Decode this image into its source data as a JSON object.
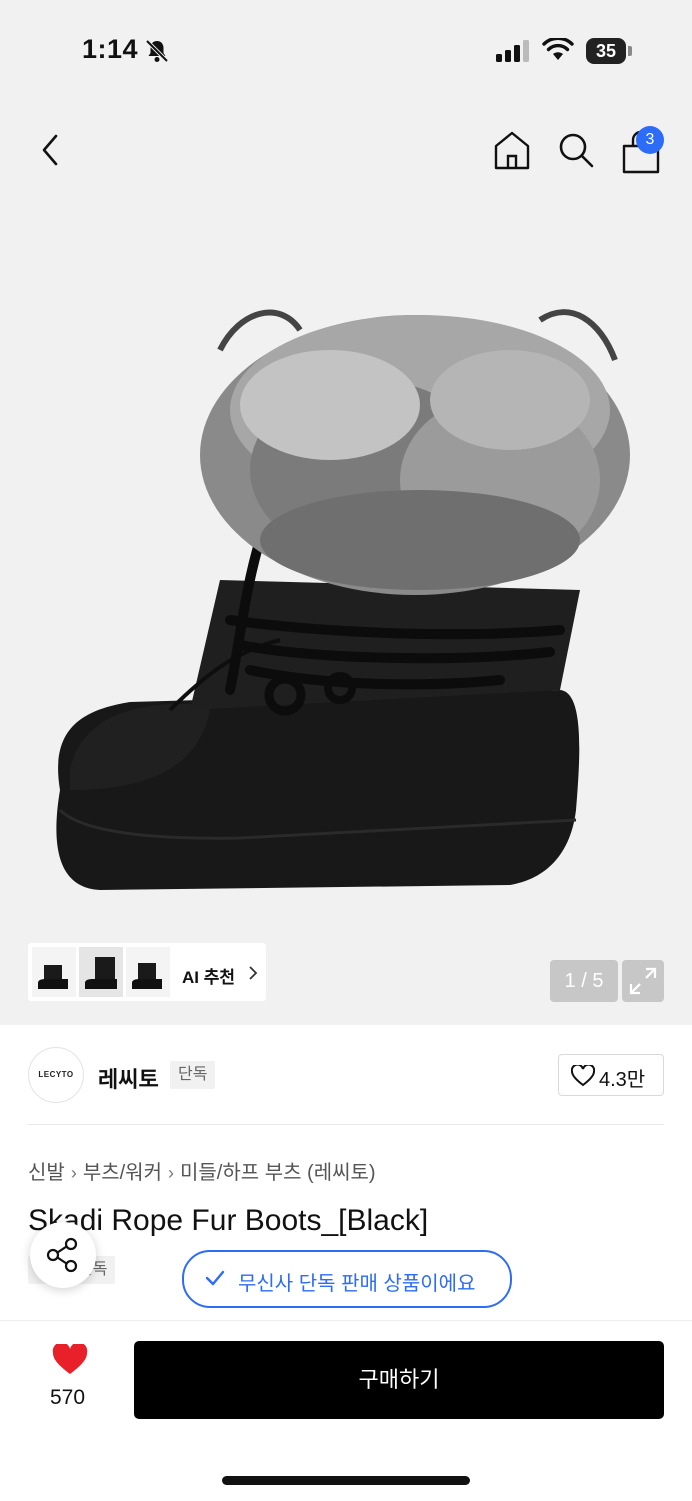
{
  "status_bar": {
    "time": "1:14",
    "battery": "35"
  },
  "header": {
    "cart_count": "3"
  },
  "gallery": {
    "ai_label": "AI 추천",
    "counter": "1 / 5"
  },
  "brand": {
    "logo_text": "LECYTO",
    "name": "레씨토",
    "tag": "단독",
    "likes": "4.3만"
  },
  "breadcrumb": [
    "신발",
    "부츠/워커",
    "미들/하프 부츠 (레씨토)"
  ],
  "product": {
    "title": "Skadi Rope Fur Boots_[Black]",
    "exclusive_tag": "단독",
    "exclusive_notice": "무신사 단독 판매 상품이에요"
  },
  "bottom_bar": {
    "wish_count": "570",
    "buy_label": "구매하기"
  },
  "colors": {
    "accent_blue": "#2d6cf6",
    "heart_red": "#e8202a",
    "buy_bg": "#000000"
  }
}
